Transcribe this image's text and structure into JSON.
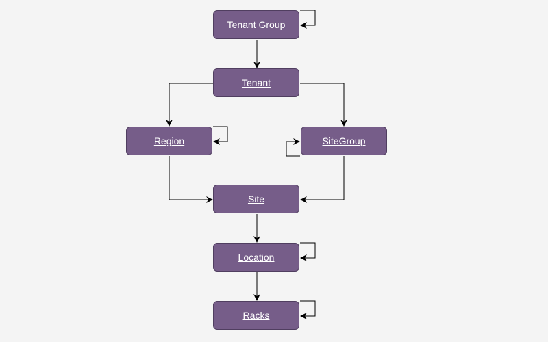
{
  "diagram": {
    "nodes": [
      {
        "id": "tenant-group",
        "label": "Tenant Group",
        "self_loop": true
      },
      {
        "id": "tenant",
        "label": "Tenant",
        "self_loop": false
      },
      {
        "id": "region",
        "label": "Region",
        "self_loop": true
      },
      {
        "id": "sitegroup",
        "label": "SiteGroup",
        "self_loop": true
      },
      {
        "id": "site",
        "label": "Site",
        "self_loop": false
      },
      {
        "id": "location",
        "label": "Location",
        "self_loop": true
      },
      {
        "id": "racks",
        "label": "Racks",
        "self_loop": true
      }
    ],
    "edges": [
      {
        "from": "Tenant Group",
        "to": "Tenant"
      },
      {
        "from": "Tenant",
        "to": "Region"
      },
      {
        "from": "Tenant",
        "to": "SiteGroup"
      },
      {
        "from": "Region",
        "to": "Site"
      },
      {
        "from": "SiteGroup",
        "to": "Site"
      },
      {
        "from": "Site",
        "to": "Location"
      },
      {
        "from": "Location",
        "to": "Racks"
      }
    ],
    "colors": {
      "node_fill": "#765d89",
      "node_border": "#503e60",
      "edge": "#000000",
      "background": "#f4f4f4"
    }
  }
}
